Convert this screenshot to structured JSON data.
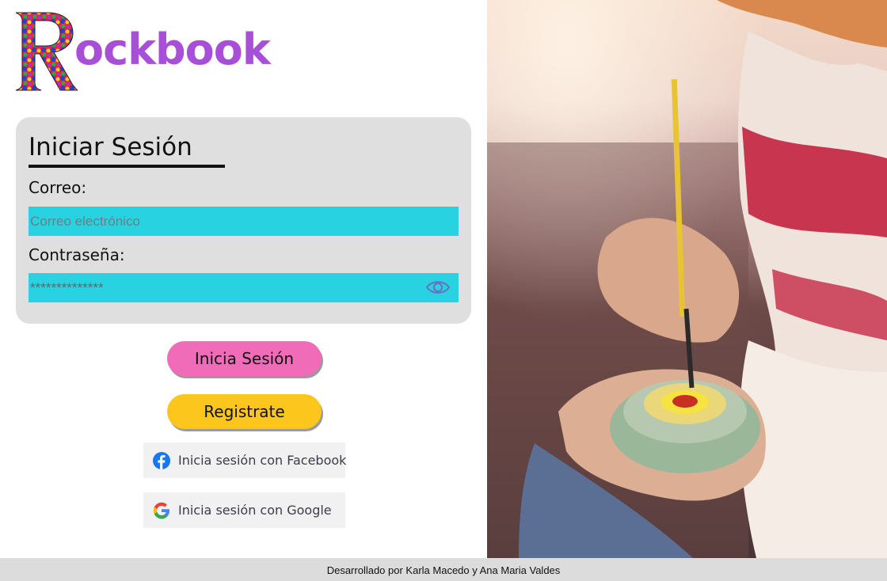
{
  "brand": {
    "initial": "R",
    "rest": "ockbook",
    "color": "#a74fd6"
  },
  "login_card": {
    "title": "Iniciar Sesión",
    "email_label": "Correo:",
    "email_placeholder": "Correo electrónico",
    "password_label": "Contraseña:",
    "password_value": "**************",
    "show_password_icon": "eye-icon"
  },
  "buttons": {
    "login": "Inicia Sesión",
    "register": "Registrate",
    "login_color": "#f06bb8",
    "register_color": "#fdc61d"
  },
  "social": {
    "facebook": "Inicia sesión con Facebook",
    "google": "Inicia sesión con Google",
    "facebook_icon": "facebook-icon",
    "google_icon": "google-icon"
  },
  "colors": {
    "input_bg": "#29d2e0",
    "card_bg": "#dfdfdf"
  },
  "footer": {
    "credits": "Desarrollado por Karla Macedo y Ana Maria Valdes"
  }
}
